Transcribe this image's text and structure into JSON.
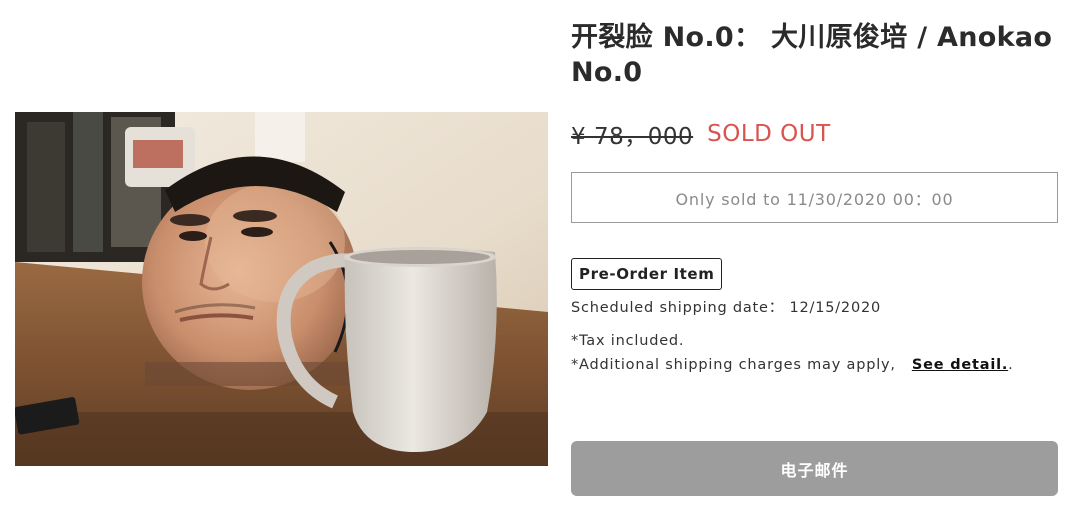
{
  "product": {
    "title": "开裂脸 No.0： 大川原俊培 / Anokao No.0",
    "price": "¥ 78，000",
    "status": "SOLD OUT",
    "sale_window": "Only sold to 11/30/2020 00：00",
    "badge": "Pre-Order Item",
    "shipping_date": "Scheduled shipping date： 12/15/2020",
    "tax_note": "*Tax included.",
    "shipping_note": "*Additional shipping charges may apply,",
    "detail_link": "See detail.",
    "detail_suffix": ".",
    "email_button": "电子邮件"
  },
  "photo": {
    "subject": "product-photo"
  },
  "colors": {
    "sold_out": "#d9534f",
    "button_bg": "#9d9d9d",
    "border": "#9a9a9a"
  }
}
